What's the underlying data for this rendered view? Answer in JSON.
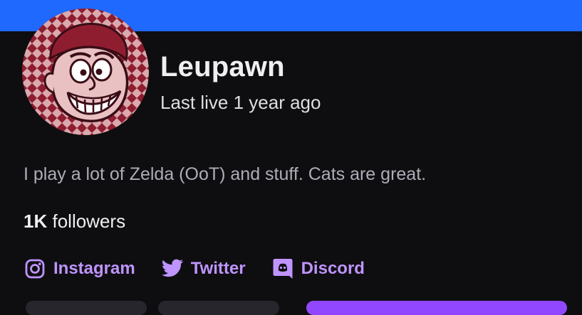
{
  "colors": {
    "banner": "#1f69ff",
    "background": "#0e0e10",
    "link": "#bf94ff",
    "avatar_bg": "#8f1d30",
    "primary_button": "#9147ff"
  },
  "channel": {
    "name": "Leupawn",
    "last_live": "Last live 1 year ago",
    "bio": "I play a lot of Zelda (OoT) and stuff. Cats are great.",
    "followers_count": "1K",
    "followers_label": "followers"
  },
  "socials": [
    {
      "label": "Instagram",
      "icon": "instagram-icon"
    },
    {
      "label": "Twitter",
      "icon": "twitter-icon"
    },
    {
      "label": "Discord",
      "icon": "discord-icon"
    }
  ]
}
